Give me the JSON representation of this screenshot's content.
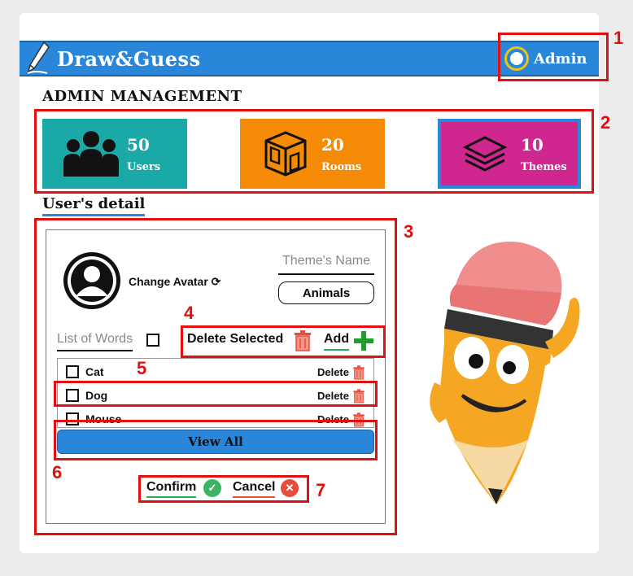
{
  "header": {
    "app_title": "Draw&Guess",
    "user_name": "Admin"
  },
  "section_title": "ADMIN MANAGEMENT",
  "stats": [
    {
      "value": "50",
      "label": "Users",
      "color": "#1aa9a6"
    },
    {
      "value": "20",
      "label": "Rooms",
      "color": "#f58a07"
    },
    {
      "value": "10",
      "label": "Themes",
      "color": "#d0268f"
    }
  ],
  "detail": {
    "title": "User's detail",
    "change_avatar": "Change Avatar",
    "theme_label": "Theme's Name",
    "theme_value": "Animals",
    "list_label": "List of Words",
    "delete_selected": "Delete Selected",
    "add": "Add",
    "words": [
      {
        "word": "Cat",
        "delete": "Delete"
      },
      {
        "word": "Dog",
        "delete": "Delete"
      },
      {
        "word": "Mouse",
        "delete": "Delete"
      }
    ],
    "view_all": "View All",
    "confirm": "Confirm",
    "cancel": "Cancel"
  },
  "annotations": [
    "1",
    "2",
    "3",
    "4",
    "5",
    "6",
    "7"
  ],
  "colors": {
    "header": "#2a86d9",
    "annotation": "#e01010",
    "confirm": "#27ae60",
    "cancel": "#e74c3c"
  }
}
